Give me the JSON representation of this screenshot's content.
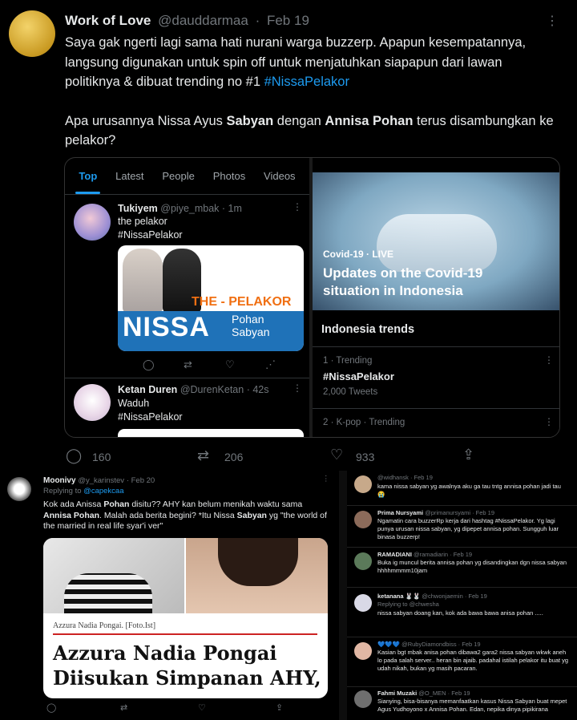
{
  "main": {
    "name": "Work of Love",
    "handle": "@dauddarmaa",
    "dot": "·",
    "date": "Feb 19",
    "more": "⋮",
    "line1": "Saya gak ngerti lagi sama hati nurani warga buzzerp. Apapun kesempatannya, langsung digunakan untuk spin off untuk menjatuhkan siapapun dari lawan politiknya & dibuat trending no #1 ",
    "hashtag": "#NissaPelakor",
    "p2a": "Apa urusannya Nissa Ayus ",
    "p2b": "Sabyan",
    "p2c": " dengan ",
    "p2d": "Annisa Pohan",
    "p2e": " terus disambungkan ke pelakor?",
    "replies": "160",
    "retweets": "206",
    "likes": "933"
  },
  "embed": {
    "tabs": [
      "Top",
      "Latest",
      "People",
      "Photos",
      "Videos"
    ],
    "t1": {
      "name": "Tukiyem",
      "handle": "@piye_mbak",
      "time": "· 1m",
      "text": "the pelakor",
      "tag": "#NissaPelakor"
    },
    "media": {
      "pelakor": "THE - PELAKOR",
      "nissa": "NISSA",
      "pohan": "Pohan",
      "sabyan": "Sabyan"
    },
    "t2": {
      "name": "Ketan Duren",
      "handle": "@DurenKetan",
      "time": "· 42s",
      "text": "Waduh",
      "tag": "#NissaPelakor"
    },
    "covid": {
      "label": "Covid-19 · LIVE",
      "title": "Updates on the Covid-19 situation in Indonesia"
    },
    "trends_title": "Indonesia trends",
    "tr1": {
      "rank": "1 · Trending",
      "name": "#NissaPelakor",
      "count": "2,000 Tweets"
    },
    "tr2": {
      "rank": "2 · K-pop · Trending"
    }
  },
  "left": {
    "name": "Moonivy",
    "handle": "@y_karinstev",
    "date": "· Feb 20",
    "reply_to": "Replying to ",
    "reply_handle": "@capekcaa",
    "text1": "Kok ada Anissa ",
    "b1": "Pohan",
    "text2": " disitu?? AHY kan belum menikah waktu sama ",
    "b2": "Annisa Pohan",
    "text3": ". Malah ada berita begini? *Itu Nissa ",
    "b3": "Sabyan",
    "text4": " yg \"the world of the married in real life syar'i ver\"",
    "caption": "Azzura Nadia Pongai. [Foto.Ist]",
    "headline": "Azzura Nadia Pongai Diisukan Simpanan AHY,"
  },
  "right": {
    "r1": {
      "handle": "@widhansk · Feb 19",
      "text": "kama nissa sabyan yg awalnya aku ga tau tntg annisa pohan jadi tau 😭"
    },
    "r2": {
      "name": "Prima Nursyami",
      "handle": "@primanursyami · Feb 19",
      "text": "Ngamatin cara buzzerRp kerja dari hashtag #NissaPelakor. Yg lagi punya urusan nissa sabyan, yg dipepet annisa pohan. Sungguh luar binasa buzzerp!"
    },
    "r3": {
      "name": "RAMADIANI",
      "handle": "@ramadiarin · Feb 19",
      "text": "Buka ig muncul berita annisa pohan yg disandingkan dgn nissa sabyan hhhhmmmm10jam"
    },
    "r4": {
      "name": "ketanana 🐰🐰",
      "handle": "@chwonjaemin · Feb 19",
      "reply": "Replying to @chwesha",
      "text": "nissa sabyan doang kan, kok ada bawa bawa anisa pohan ....."
    },
    "r5": {
      "name": "💙💙💙",
      "handle": "@RubyDiamondbiss · Feb 19",
      "text": "Kasian bgt mbak anisa pohan dibawa2 gara2 nissa sabyan wkwk aneh lo pada salah server.. heran bin ajaib. padahal istilah pelakor itu buat yg udah nikah, bukan yg masih pacaran."
    },
    "r6": {
      "name": "Fahmi Muzaki",
      "handle": "@O_MEN · Feb 19",
      "text": "Sianying, bisa-bisanya memanfaatkan kasus Nissa Sabyan buat mepet Agus Yudhoyono x Annisa Pohan. Edan, nepika dinya pipikirana"
    }
  },
  "colors": {
    "accent": "#1d9bf0",
    "bg": "#000000",
    "muted": "#71767b"
  }
}
